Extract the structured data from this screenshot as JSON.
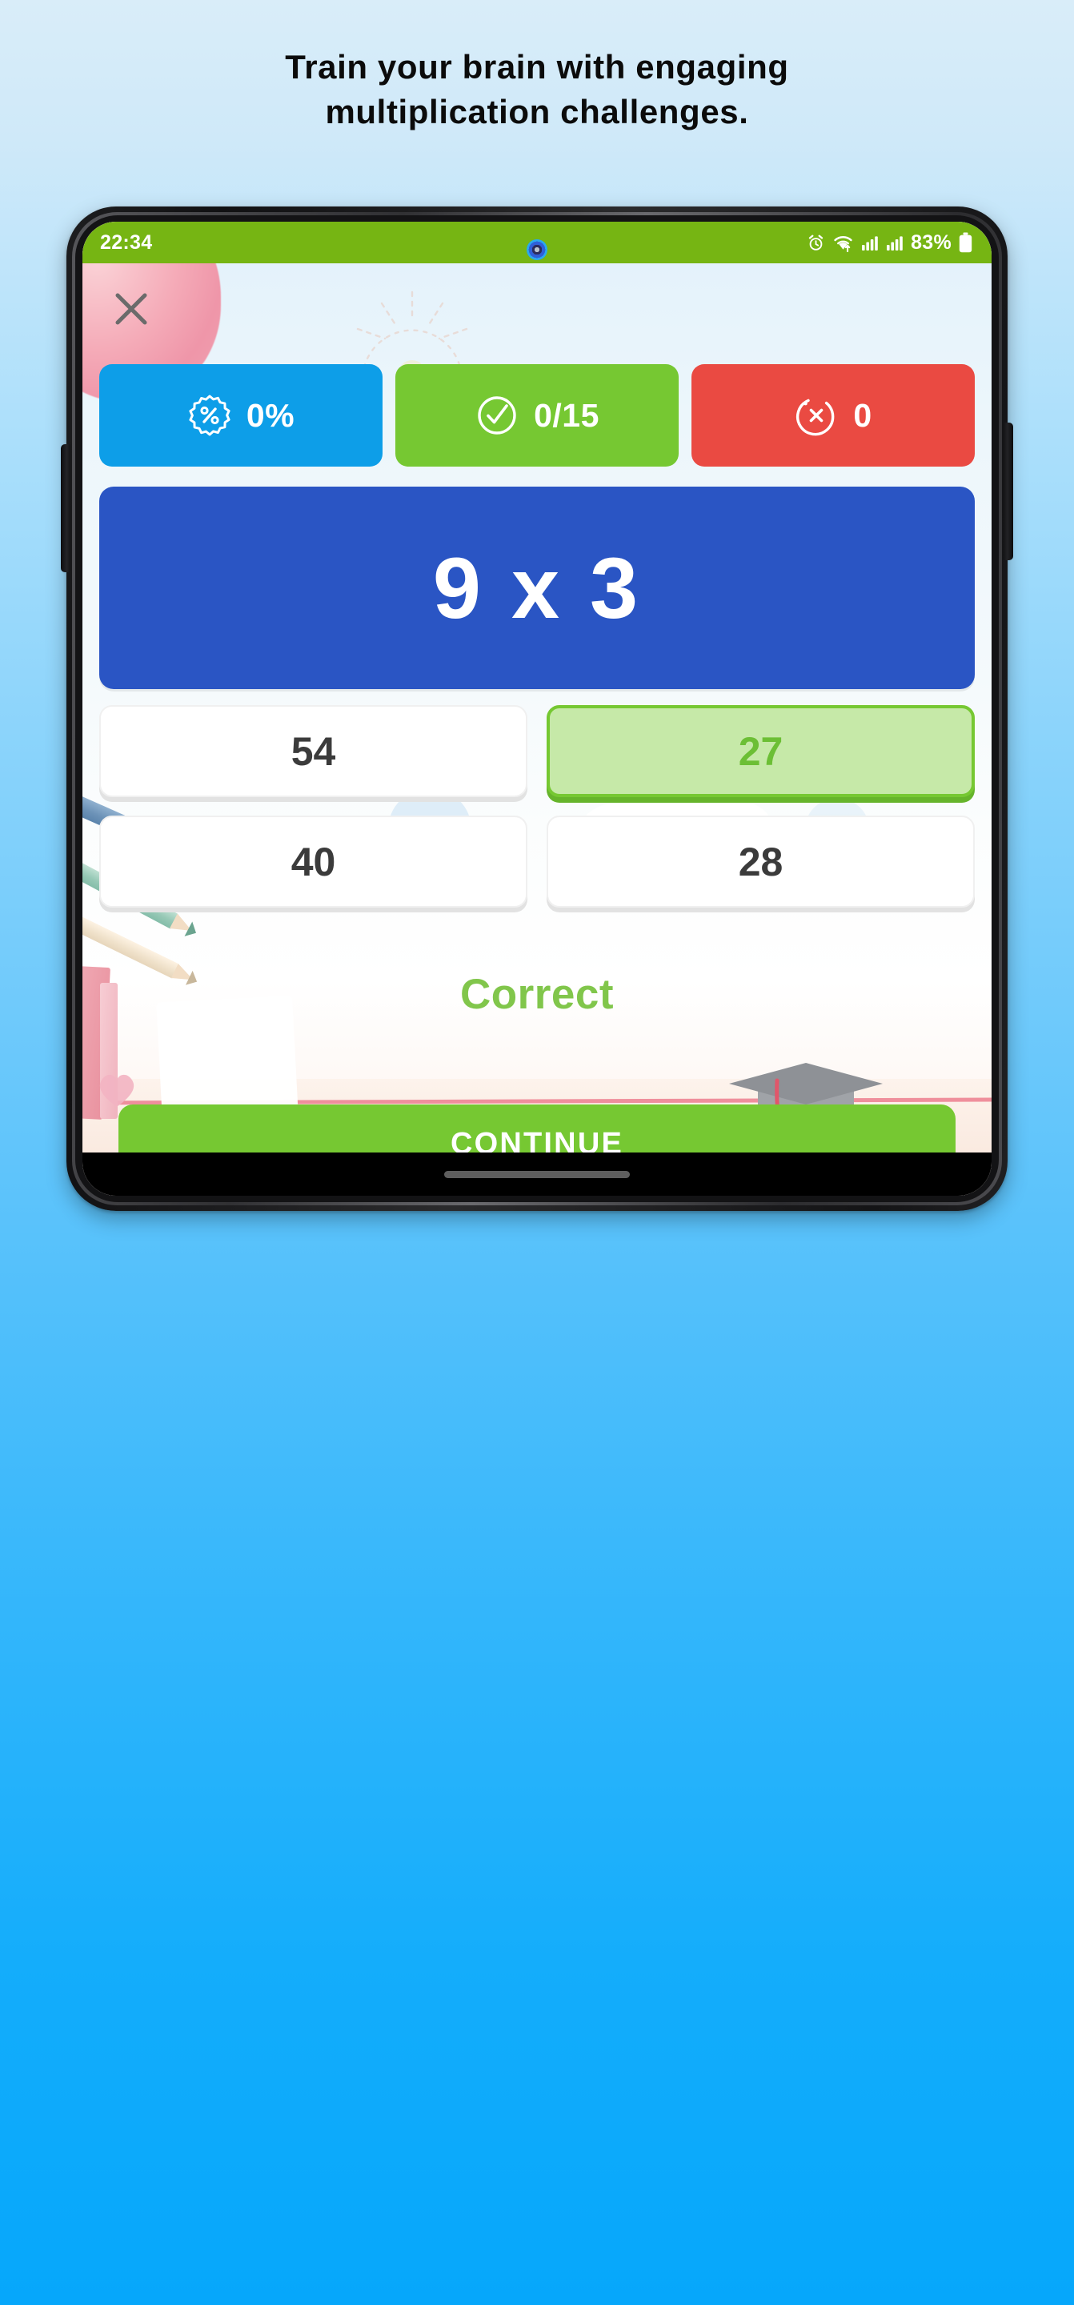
{
  "headline": {
    "line1": "Train your brain with engaging",
    "line2": "multiplication challenges."
  },
  "phone": {
    "statusbar": {
      "time": "22:34",
      "battery_percent": "83%",
      "icons": [
        "alarm-icon",
        "wifi-icon",
        "signal-icon",
        "signal-icon-2",
        "battery-icon"
      ]
    },
    "navbar": {
      "handle": "gesture-handle"
    }
  },
  "app": {
    "close_label": "✕",
    "stats": [
      {
        "id": "accuracy",
        "icon": "percent-badge-icon",
        "value": "0%",
        "bg": "#0d9ee8"
      },
      {
        "id": "correct",
        "icon": "check-circle-icon",
        "value": "0/15",
        "bg": "#76c832"
      },
      {
        "id": "incorrect",
        "icon": "x-circle-icon",
        "value": "0",
        "bg": "#ea4a42"
      }
    ],
    "question": {
      "text": "9 x 3",
      "left_operand": "9",
      "operator": "x",
      "right_operand": "3",
      "bg": "#2a55c4"
    },
    "answers": [
      {
        "label": "54",
        "state": "default"
      },
      {
        "label": "27",
        "state": "correct"
      },
      {
        "label": "40",
        "state": "default"
      },
      {
        "label": "28",
        "state": "default"
      }
    ],
    "verdict": {
      "text": "Correct",
      "color": "#81c64b"
    },
    "continue": {
      "label": "CONTINUE",
      "bg": "#76c832"
    }
  }
}
